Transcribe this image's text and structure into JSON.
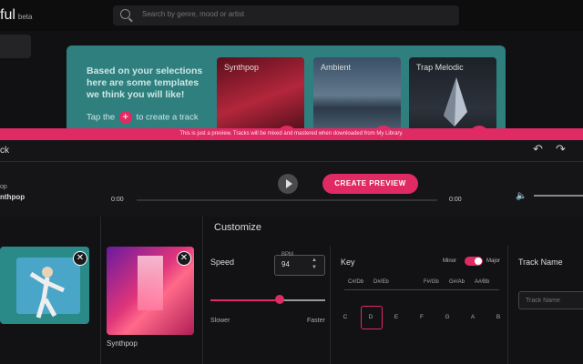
{
  "header": {
    "logo_text": "ful",
    "logo_badge": "beta",
    "search_placeholder": "Search by genre, mood or artist"
  },
  "banner": {
    "headline": "Based on your selections here are some templates we think you will like!",
    "tap_before": "Tap the",
    "tap_after": "to create a track",
    "cards": [
      {
        "label": "Synthpop"
      },
      {
        "label": "Ambient"
      },
      {
        "label": "Trap Melodic"
      }
    ]
  },
  "notice": "This is just a preview. Tracks will be mixed and mastered when downloaded from My Library.",
  "player": {
    "back_label": "ck",
    "meta_label": "op",
    "meta_title": "nthpop",
    "preview_button": "CREATE PREVIEW",
    "time_start": "0:00",
    "time_end": "0:00"
  },
  "customize": {
    "title": "Customize",
    "template_label": "Synthpop",
    "speed": {
      "label": "Speed",
      "bpm_label": "BPM",
      "bpm_value": "94",
      "slower": "Slower",
      "faster": "Faster",
      "level": 0.6
    },
    "key": {
      "label": "Key",
      "minor": "Minor",
      "major": "Major",
      "sharps": [
        "C#/Db",
        "D#/Eb",
        "F#/Gb",
        "G#/Ab",
        "A#/Bb"
      ],
      "notes": [
        "C",
        "D",
        "E",
        "F",
        "G",
        "A",
        "B"
      ],
      "selected": "D",
      "mode_selected": "Major"
    },
    "track_name": {
      "label": "Track Name",
      "placeholder": "Track Name"
    }
  },
  "colors": {
    "accent": "#e02a63",
    "banner": "#2f7f7f"
  }
}
